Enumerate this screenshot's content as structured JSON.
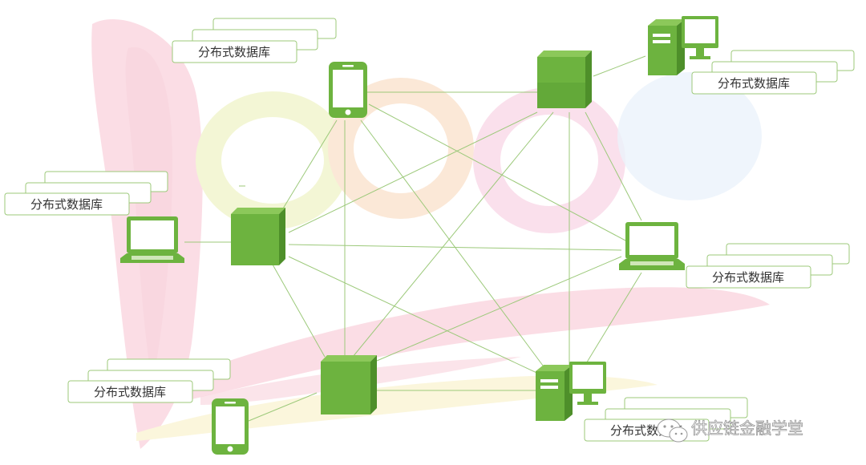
{
  "labels": {
    "db1": "分布式数据库",
    "db2": "分布式数据库",
    "db3": "分布式数据库",
    "db4": "分布式数据库",
    "db5": "分布式数据库",
    "db6": "分布式数据库"
  },
  "watermark": {
    "text": "供应链金融学堂"
  },
  "colors": {
    "node_green": "#6db33f",
    "node_green_dark": "#4e8f2a",
    "node_green_light": "#8cc85a",
    "edge": "#9cc97a",
    "box_border": "#9cc97a"
  },
  "icons": {
    "phone": "smartphone-icon",
    "laptop": "laptop-icon",
    "server": "server-cube-icon",
    "desktop": "desktop-computer-icon",
    "wechat": "wechat-icon"
  }
}
